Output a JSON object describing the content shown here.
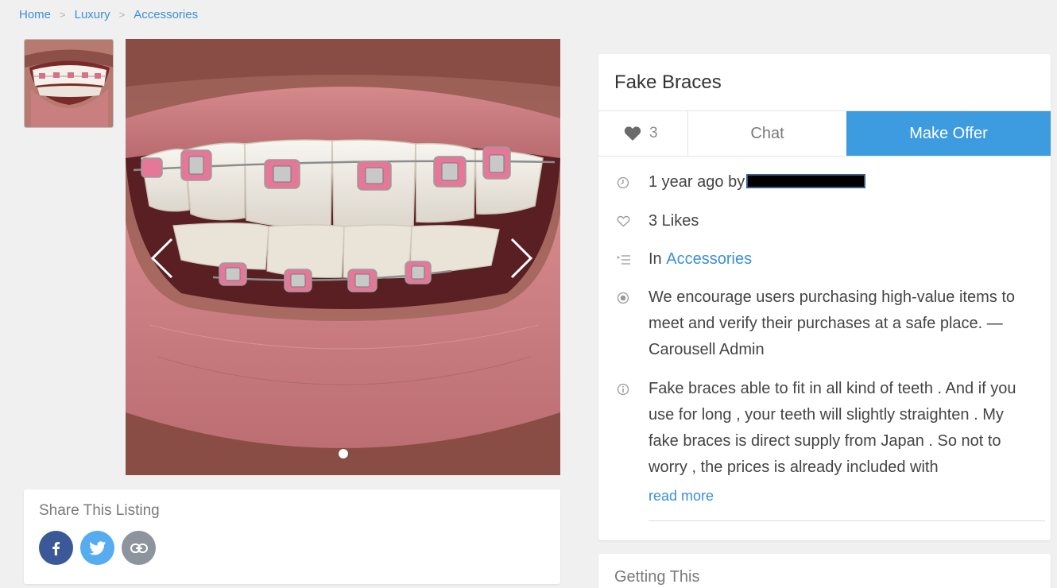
{
  "breadcrumb": {
    "home": "Home",
    "category": "Luxury",
    "subcategory": "Accessories"
  },
  "listing": {
    "title": "Fake Braces",
    "like_count": "3",
    "chat_label": "Chat",
    "offer_label": "Make Offer",
    "posted_text": "1 year ago by",
    "likes_text": "3 Likes",
    "in_text": "In",
    "category_link": "Accessories",
    "safety_notice": "We encourage users purchasing high-value items to meet and verify their purchases at a safe place. — Carousell Admin",
    "description": "Fake braces able to fit in all kind of teeth . And if you use for long , your teeth will slightly straighten . My fake braces is direct supply from Japan . So not to worry , the prices is already included with",
    "read_more": "read more"
  },
  "share": {
    "title": "Share This Listing",
    "icons": [
      "facebook-icon",
      "twitter-icon",
      "link-icon"
    ]
  },
  "getting": {
    "title": "Getting This"
  },
  "carousel": {
    "current_slide": 1,
    "total_slides": 1
  },
  "colors": {
    "accent": "#3d9be0",
    "link": "#3a8fd8",
    "facebook": "#3b5998",
    "twitter": "#55acee"
  }
}
